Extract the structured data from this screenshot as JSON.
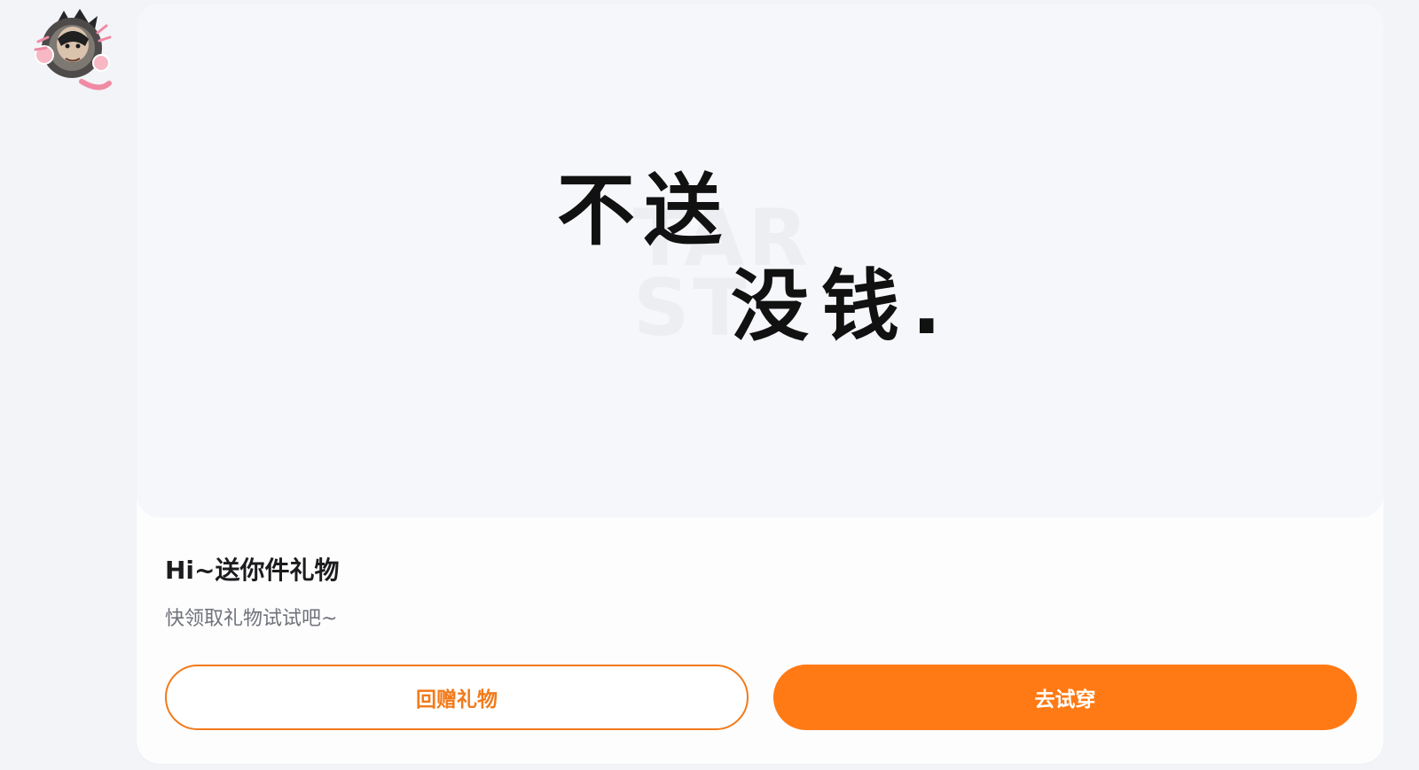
{
  "gift": {
    "sticker_text": {
      "line1": "不送",
      "line2": "没钱."
    },
    "title": "Hi~送你件礼物",
    "subtitle": "快领取礼物试试吧~"
  },
  "actions": {
    "return_gift_label": "回赠礼物",
    "try_on_label": "去试穿"
  },
  "colors": {
    "accent": "#ff7a14",
    "page_background": "#f2f4f8"
  },
  "icons": {
    "avatar": "cat-avatar-icon"
  }
}
